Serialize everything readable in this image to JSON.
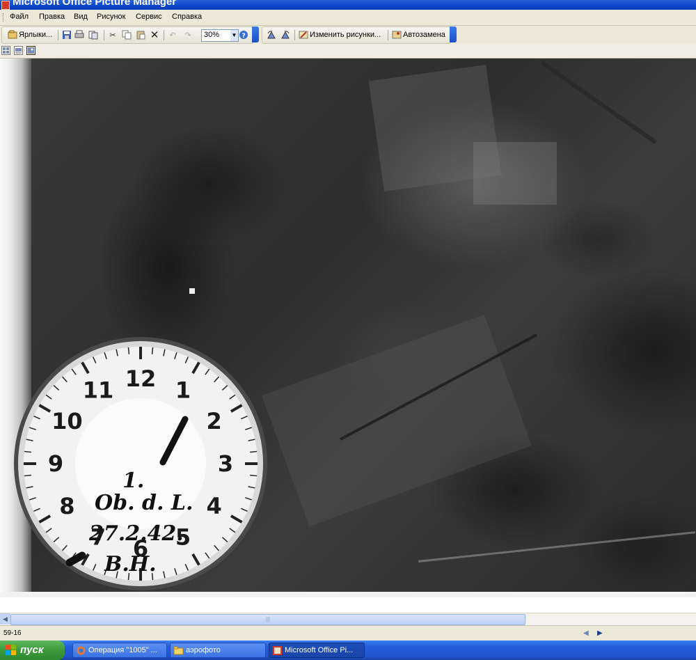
{
  "window": {
    "title": "Microsoft Office Picture Manager"
  },
  "menubar": {
    "items": [
      {
        "label": "Файл"
      },
      {
        "label": "Правка"
      },
      {
        "label": "Вид"
      },
      {
        "label": "Рисунок"
      },
      {
        "label": "Сервис"
      },
      {
        "label": "Справка"
      }
    ]
  },
  "toolbar": {
    "shortcuts_label": "Ярлыки...",
    "zoom_value": "30%",
    "edit_pictures_label": "Изменить рисунки...",
    "autocorrect_label": "Автозамена",
    "icons": [
      "shortcuts-icon",
      "save-icon",
      "print-icon",
      "copy-to-icon",
      "cut-icon",
      "copy-icon",
      "paste-icon",
      "delete-icon",
      "undo-icon",
      "redo-icon",
      "help-icon",
      "rotate-left-icon",
      "rotate-right-icon",
      "edit-pictures-icon",
      "autocorrect-icon"
    ]
  },
  "view_buttons": [
    "thumbnail-view",
    "filmstrip-view",
    "single-picture-view"
  ],
  "photo": {
    "clock_numbers": [
      "12",
      "1",
      "2",
      "3",
      "4",
      "5",
      "6",
      "7",
      "8",
      "9",
      "10",
      "11"
    ],
    "handwritten_note": [
      "1.",
      "Ob. d. L.",
      "27.2.42.",
      "B.H."
    ]
  },
  "statusbar": {
    "text": "59-16"
  },
  "taskbar": {
    "start_label": "пуск",
    "tasks": [
      {
        "label": "Операция \"1005\" ..."
      },
      {
        "label": "аэрофото"
      },
      {
        "label": "Microsoft Office Pi..."
      }
    ]
  },
  "colors": {
    "titlebar": "#0b45c8",
    "menubar": "#ece9d8",
    "taskbar": "#245edb",
    "start": "#3c9a3c"
  }
}
